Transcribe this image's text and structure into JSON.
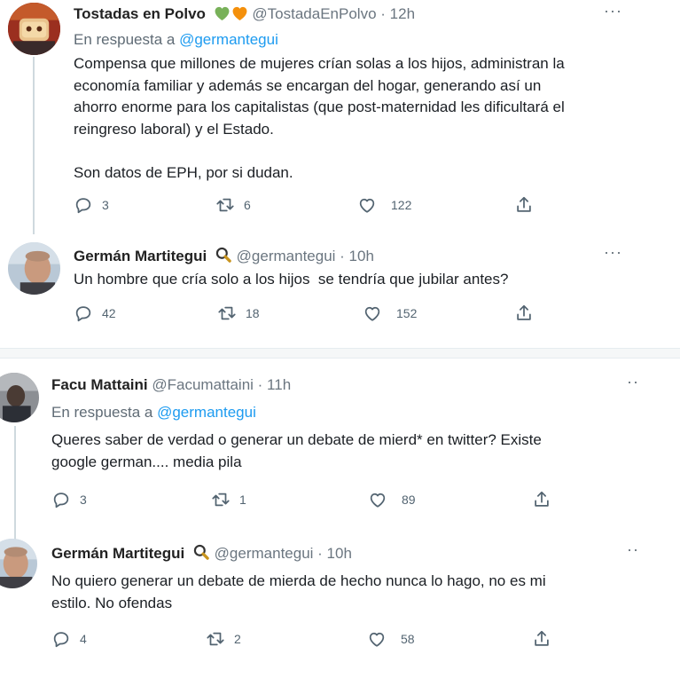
{
  "tweets": [
    {
      "name": "Tostadas en Polvo",
      "badges": [
        "green-heart",
        "orange-heart"
      ],
      "handle": "@TostadaEnPolvo",
      "time": "12h",
      "reply_prefix": "En respuesta a",
      "reply_handle": "@germantegui",
      "text": "Compensa que millones de mujeres crían solas a los hijos, administran la\neconomía familiar y además se encargan del hogar, generando así un\nahorro enorme para los capitalistas (que post-maternidad les dificultará el\nreingreso laboral) y el Estado.\n\nSon datos de EPH, por si dudan.",
      "replies": "3",
      "retweets": "6",
      "likes": "122",
      "more": "···"
    },
    {
      "name": "Germán Martitegui",
      "badges": [
        "magnifier-icon"
      ],
      "handle": "@germantegui",
      "time": "10h",
      "text": "Un hombre que cría solo a los hijos  se tendría que jubilar antes?",
      "replies": "42",
      "retweets": "18",
      "likes": "152",
      "more": "···"
    },
    {
      "name": "Facu Mattaini",
      "handle": "@Facumattaini",
      "time": "11h",
      "reply_prefix": "En respuesta a",
      "reply_handle": "@germantegui",
      "text": "Queres saber de verdad o generar un debate de mierd* en twitter? Existe\ngoogle german.... media pila",
      "replies": "3",
      "retweets": "1",
      "likes": "89",
      "more": "··"
    },
    {
      "name": "Germán Martitegui",
      "badges": [
        "magnifier-icon"
      ],
      "handle": "@germantegui",
      "time": "10h",
      "text": "No quiero generar un debate de mierda de hecho nunca lo hago, no es mi\nestilo. No ofendas",
      "replies": "4",
      "retweets": "2",
      "likes": "58",
      "more": "··"
    }
  ],
  "separator": " · ",
  "colors": {
    "link": "#1d9bf0",
    "meta": "#6b7680",
    "icon": "#536471"
  }
}
